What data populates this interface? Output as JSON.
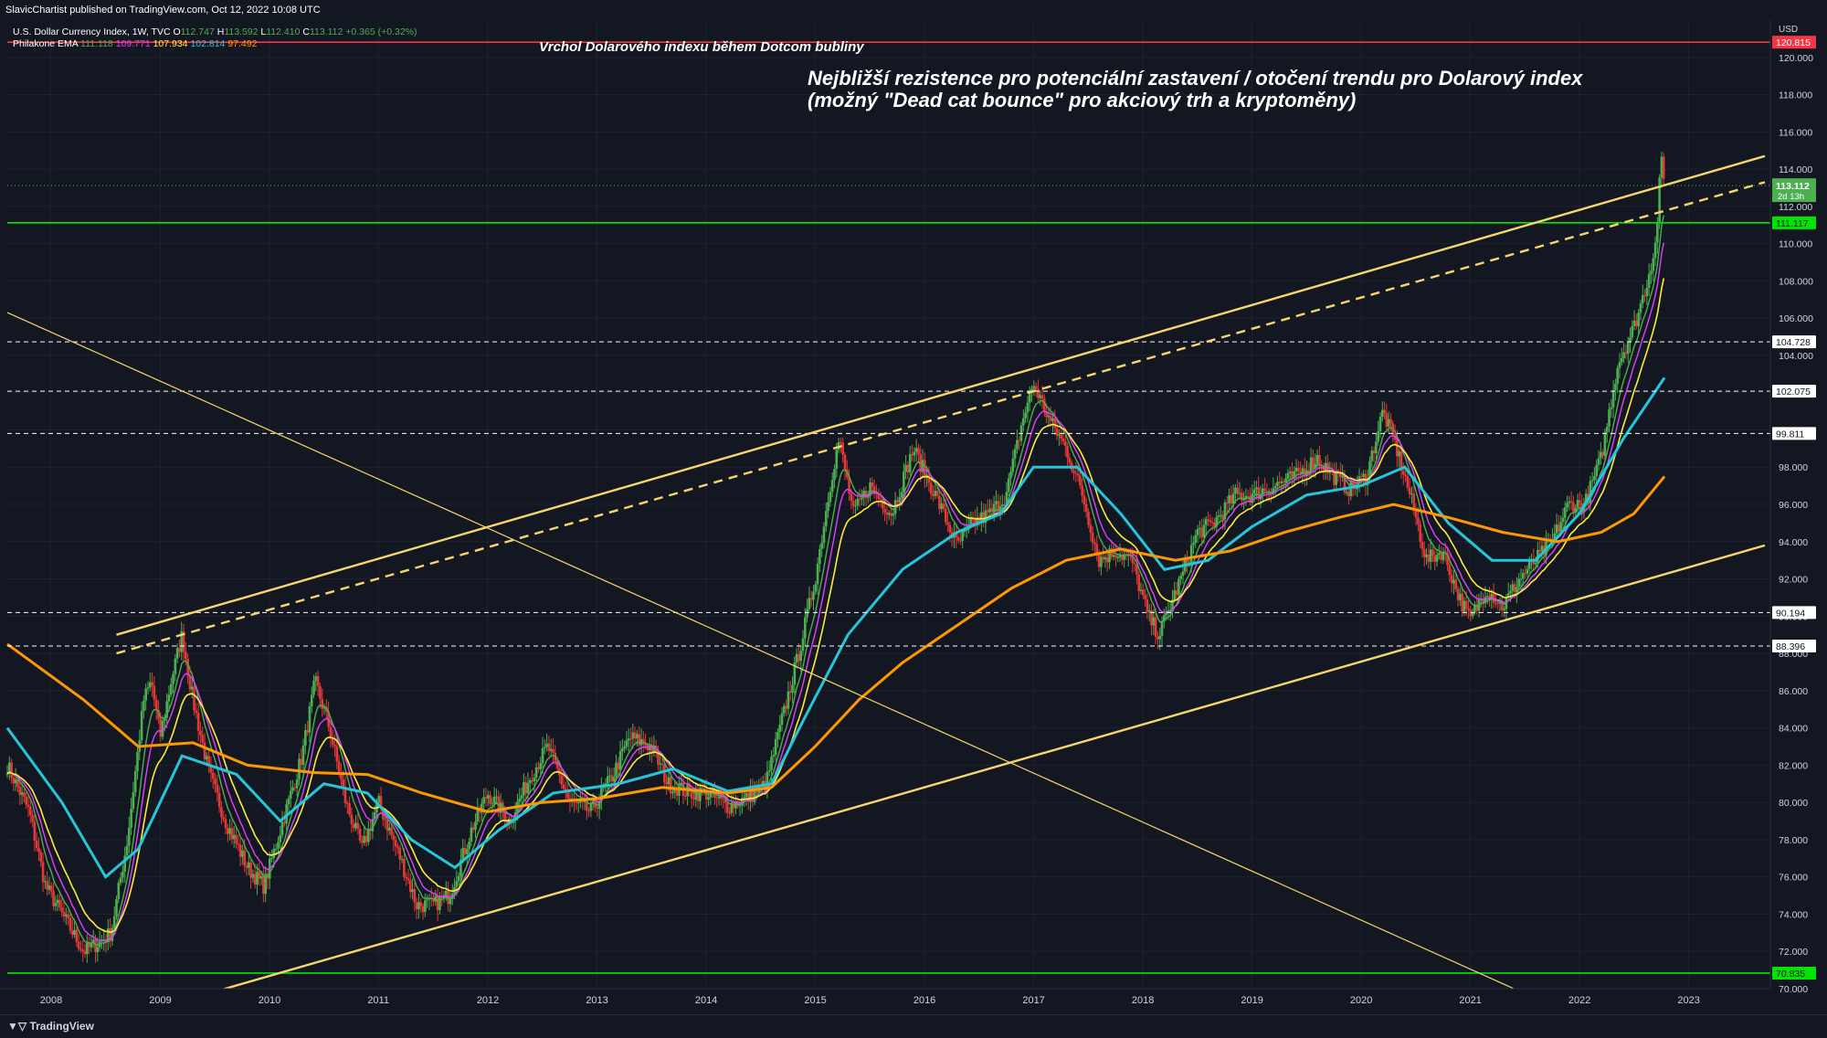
{
  "publisher_line": "SlavicChartist published on TradingView.com, Oct 12, 2022 10:08 UTC",
  "footer_brand": "TradingView",
  "legend": {
    "symbol": "U.S. Dollar Currency Index, 1W, TVC",
    "ohlc": [
      {
        "label": "O",
        "value": "112.747"
      },
      {
        "label": "H",
        "value": "113.592"
      },
      {
        "label": "L",
        "value": "112.410"
      },
      {
        "label": "C",
        "value": "113.112"
      }
    ],
    "change": "+0.365 (+0.32%)",
    "indicator_name": "Philakone EMA",
    "indicator_values": [
      {
        "value": "111.118",
        "color": "#4caf50"
      },
      {
        "value": "109.771",
        "color": "#e040fb"
      },
      {
        "value": "107.934",
        "color": "#ffeb3b"
      },
      {
        "value": "102.814",
        "color": "#26c6da"
      },
      {
        "value": "97.492",
        "color": "#ff9800"
      }
    ]
  },
  "annotations": {
    "top_title": "Vrchol Dolarového indexu během Dotcom bubliny",
    "resistance_line1": "Nejbližší rezistence pro potenciální zastavení / otočení trendu pro Dolarový index",
    "resistance_line2": "(možný \"Dead cat bounce\" pro akciový trh a kryptoměny)"
  },
  "colors": {
    "background": "#131722",
    "grid": "#1e222d",
    "axis_text": "#d1d4dc",
    "candle_up": "#4caf50",
    "candle_down": "#e53935",
    "ema1": "#4caf50",
    "ema2": "#e040fb",
    "ema3": "#ffeb3b",
    "ema4": "#26c6da",
    "ema5": "#ff9800",
    "trendline": "#f5d76e",
    "red_level": "#f23645",
    "green_level": "#00e600"
  },
  "chart_data": {
    "type": "candlestick",
    "currency": "USD",
    "x_axis": {
      "range": [
        2007.6,
        2023.75
      ],
      "ticks": [
        "2008",
        "2009",
        "2010",
        "2011",
        "2012",
        "2013",
        "2014",
        "2015",
        "2016",
        "2017",
        "2018",
        "2019",
        "2020",
        "2021",
        "2022",
        "2023"
      ]
    },
    "y_axis": {
      "range": [
        70.0,
        122.0
      ],
      "ticks": [
        "70.000",
        "72.000",
        "74.000",
        "76.000",
        "78.000",
        "80.000",
        "82.000",
        "84.000",
        "86.000",
        "88.000",
        "90.000",
        "92.000",
        "94.000",
        "96.000",
        "98.000",
        "100.000",
        "102.000",
        "104.000",
        "106.000",
        "108.000",
        "110.000",
        "112.000",
        "114.000",
        "116.000",
        "118.000",
        "120.000"
      ]
    },
    "price_points": [
      [
        2007.6,
        82.0
      ],
      [
        2007.8,
        79.5
      ],
      [
        2007.95,
        75.5
      ],
      [
        2008.15,
        73.5
      ],
      [
        2008.3,
        72.0
      ],
      [
        2008.45,
        72.5
      ],
      [
        2008.55,
        73.0
      ],
      [
        2008.7,
        78.0
      ],
      [
        2008.85,
        85.5
      ],
      [
        2008.92,
        86.5
      ],
      [
        2009.0,
        83.5
      ],
      [
        2009.1,
        86.5
      ],
      [
        2009.2,
        89.0
      ],
      [
        2009.3,
        85.5
      ],
      [
        2009.45,
        81.5
      ],
      [
        2009.6,
        79.0
      ],
      [
        2009.8,
        76.5
      ],
      [
        2009.95,
        75.5
      ],
      [
        2010.1,
        78.5
      ],
      [
        2010.3,
        82.5
      ],
      [
        2010.42,
        86.5
      ],
      [
        2010.55,
        84.0
      ],
      [
        2010.7,
        80.0
      ],
      [
        2010.85,
        77.5
      ],
      [
        2011.0,
        80.0
      ],
      [
        2011.2,
        77.0
      ],
      [
        2011.35,
        74.5
      ],
      [
        2011.5,
        74.5
      ],
      [
        2011.65,
        75.0
      ],
      [
        2011.85,
        78.5
      ],
      [
        2012.0,
        80.5
      ],
      [
        2012.2,
        79.0
      ],
      [
        2012.4,
        81.5
      ],
      [
        2012.55,
        83.0
      ],
      [
        2012.75,
        80.0
      ],
      [
        2012.95,
        79.5
      ],
      [
        2013.15,
        81.5
      ],
      [
        2013.3,
        83.5
      ],
      [
        2013.5,
        83.0
      ],
      [
        2013.65,
        81.0
      ],
      [
        2013.85,
        80.5
      ],
      [
        2014.0,
        80.5
      ],
      [
        2014.2,
        79.8
      ],
      [
        2014.4,
        80.3
      ],
      [
        2014.55,
        81.0
      ],
      [
        2014.7,
        84.5
      ],
      [
        2014.85,
        88.0
      ],
      [
        2015.0,
        92.0
      ],
      [
        2015.15,
        97.5
      ],
      [
        2015.22,
        99.5
      ],
      [
        2015.35,
        95.5
      ],
      [
        2015.5,
        97.0
      ],
      [
        2015.7,
        95.5
      ],
      [
        2015.9,
        99.0
      ],
      [
        2016.1,
        96.5
      ],
      [
        2016.3,
        93.8
      ],
      [
        2016.45,
        95.0
      ],
      [
        2016.6,
        95.5
      ],
      [
        2016.75,
        96.5
      ],
      [
        2016.9,
        100.5
      ],
      [
        2017.0,
        102.5
      ],
      [
        2017.15,
        100.5
      ],
      [
        2017.3,
        99.0
      ],
      [
        2017.45,
        96.5
      ],
      [
        2017.6,
        93.0
      ],
      [
        2017.75,
        93.5
      ],
      [
        2017.9,
        93.0
      ],
      [
        2018.05,
        90.0
      ],
      [
        2018.15,
        89.0
      ],
      [
        2018.35,
        92.0
      ],
      [
        2018.5,
        94.5
      ],
      [
        2018.65,
        95.0
      ],
      [
        2018.85,
        96.5
      ],
      [
        2019.0,
        96.5
      ],
      [
        2019.2,
        97.0
      ],
      [
        2019.4,
        97.5
      ],
      [
        2019.6,
        98.5
      ],
      [
        2019.75,
        97.5
      ],
      [
        2019.9,
        96.8
      ],
      [
        2020.05,
        97.5
      ],
      [
        2020.2,
        101.0
      ],
      [
        2020.3,
        99.5
      ],
      [
        2020.45,
        96.5
      ],
      [
        2020.6,
        93.0
      ],
      [
        2020.75,
        93.5
      ],
      [
        2020.9,
        91.0
      ],
      [
        2021.0,
        89.8
      ],
      [
        2021.15,
        91.5
      ],
      [
        2021.3,
        90.5
      ],
      [
        2021.45,
        92.0
      ],
      [
        2021.6,
        93.0
      ],
      [
        2021.75,
        94.0
      ],
      [
        2021.9,
        96.0
      ],
      [
        2022.05,
        96.0
      ],
      [
        2022.2,
        98.5
      ],
      [
        2022.35,
        103.5
      ],
      [
        2022.5,
        105.5
      ],
      [
        2022.6,
        107.5
      ],
      [
        2022.7,
        110.0
      ],
      [
        2022.75,
        114.5
      ],
      [
        2022.78,
        113.1
      ]
    ],
    "ema_200_points": [
      [
        2007.6,
        88.5
      ],
      [
        2008.3,
        85.5
      ],
      [
        2008.8,
        83.0
      ],
      [
        2009.3,
        83.2
      ],
      [
        2009.8,
        82.0
      ],
      [
        2010.4,
        81.6
      ],
      [
        2010.9,
        81.5
      ],
      [
        2011.4,
        80.5
      ],
      [
        2012.0,
        79.5
      ],
      [
        2012.5,
        80.0
      ],
      [
        2013.0,
        80.2
      ],
      [
        2013.6,
        80.8
      ],
      [
        2014.2,
        80.5
      ],
      [
        2014.6,
        80.8
      ],
      [
        2015.0,
        83.0
      ],
      [
        2015.4,
        85.5
      ],
      [
        2015.8,
        87.5
      ],
      [
        2016.3,
        89.5
      ],
      [
        2016.8,
        91.5
      ],
      [
        2017.3,
        93.0
      ],
      [
        2017.8,
        93.6
      ],
      [
        2018.3,
        93.0
      ],
      [
        2018.8,
        93.5
      ],
      [
        2019.3,
        94.5
      ],
      [
        2019.8,
        95.3
      ],
      [
        2020.3,
        96.0
      ],
      [
        2020.8,
        95.3
      ],
      [
        2021.3,
        94.5
      ],
      [
        2021.8,
        94.0
      ],
      [
        2022.2,
        94.5
      ],
      [
        2022.5,
        95.5
      ],
      [
        2022.78,
        97.5
      ]
    ],
    "ema_55_points": [
      [
        2007.6,
        84.0
      ],
      [
        2008.1,
        80.0
      ],
      [
        2008.5,
        76.0
      ],
      [
        2008.8,
        77.5
      ],
      [
        2009.2,
        82.5
      ],
      [
        2009.7,
        81.5
      ],
      [
        2010.1,
        79.0
      ],
      [
        2010.5,
        81.0
      ],
      [
        2010.9,
        80.5
      ],
      [
        2011.3,
        78.0
      ],
      [
        2011.7,
        76.5
      ],
      [
        2012.1,
        78.5
      ],
      [
        2012.6,
        80.5
      ],
      [
        2013.2,
        81.0
      ],
      [
        2013.7,
        81.8
      ],
      [
        2014.2,
        80.6
      ],
      [
        2014.6,
        81.0
      ],
      [
        2014.9,
        84.5
      ],
      [
        2015.3,
        89.0
      ],
      [
        2015.8,
        92.5
      ],
      [
        2016.3,
        94.5
      ],
      [
        2016.7,
        95.5
      ],
      [
        2017.0,
        98.0
      ],
      [
        2017.4,
        98.0
      ],
      [
        2017.8,
        95.5
      ],
      [
        2018.2,
        92.5
      ],
      [
        2018.6,
        93.0
      ],
      [
        2019.0,
        94.8
      ],
      [
        2019.5,
        96.5
      ],
      [
        2020.0,
        97.0
      ],
      [
        2020.4,
        98.0
      ],
      [
        2020.8,
        95.0
      ],
      [
        2021.2,
        93.0
      ],
      [
        2021.6,
        93.0
      ],
      [
        2022.0,
        95.5
      ],
      [
        2022.4,
        99.5
      ],
      [
        2022.78,
        102.8
      ]
    ],
    "levels": [
      {
        "value": "120.815",
        "color": "#f23645"
      },
      {
        "value": "111.117",
        "color": "#00e600"
      },
      {
        "value": "104.728",
        "color": "#ffffff"
      },
      {
        "value": "102.075",
        "color": "#ffffff"
      },
      {
        "value": "99.811",
        "color": "#ffffff"
      },
      {
        "value": "90.194",
        "color": "#ffffff"
      },
      {
        "value": "88.396",
        "color": "#ffffff"
      },
      {
        "value": "70.835",
        "color": "#00e600"
      }
    ],
    "last_price": {
      "value": "113.112",
      "countdown": "2d 13h"
    },
    "trendlines": [
      {
        "style": "solid",
        "from": [
          2008.6,
          89.0
        ],
        "to": [
          2023.7,
          114.7
        ]
      },
      {
        "style": "dashed",
        "from": [
          2008.6,
          88.0
        ],
        "to": [
          2023.7,
          113.3
        ]
      },
      {
        "style": "solid",
        "from": [
          2009.3,
          69.5
        ],
        "to": [
          2023.7,
          93.8
        ]
      },
      {
        "style": "thin",
        "from": [
          2007.6,
          106.3
        ],
        "to": [
          2021.4,
          70.0
        ]
      }
    ]
  }
}
